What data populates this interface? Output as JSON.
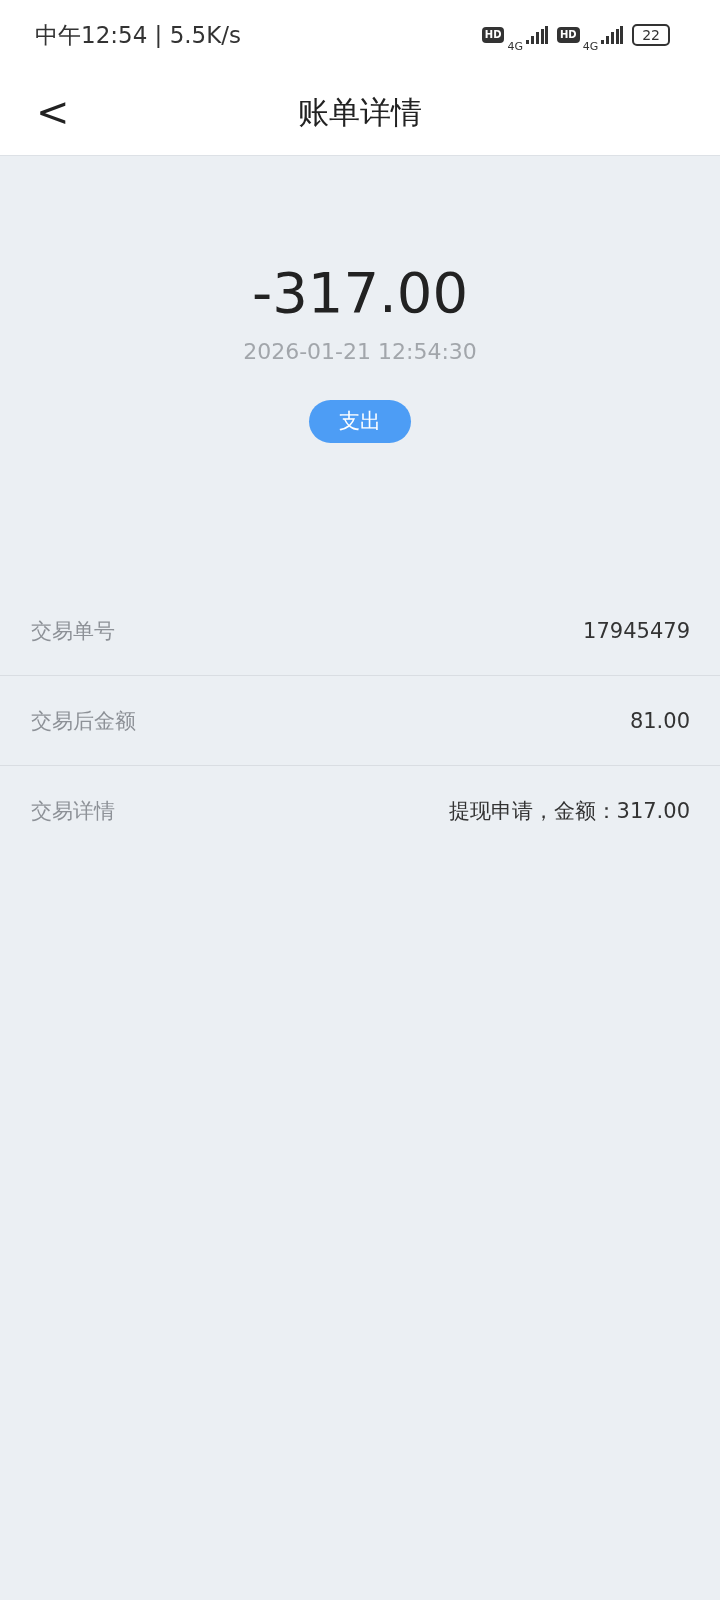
{
  "status_bar": {
    "time": "中午12:54 | 5.5K/s",
    "hd_1": "HD",
    "network_1": "4G",
    "hd_2": "HD",
    "network_2": "4G",
    "battery": "22"
  },
  "header": {
    "back": "<",
    "title": "账单详情"
  },
  "summary": {
    "amount": "-317.00",
    "datetime": "2026-01-21 12:54:30",
    "type_tag": "支出"
  },
  "details": [
    {
      "label": "交易单号",
      "value": "17945479"
    },
    {
      "label": "交易后金额",
      "value": "81.00"
    },
    {
      "label": "交易详情",
      "value": "提现申请，金额：317.00"
    }
  ]
}
